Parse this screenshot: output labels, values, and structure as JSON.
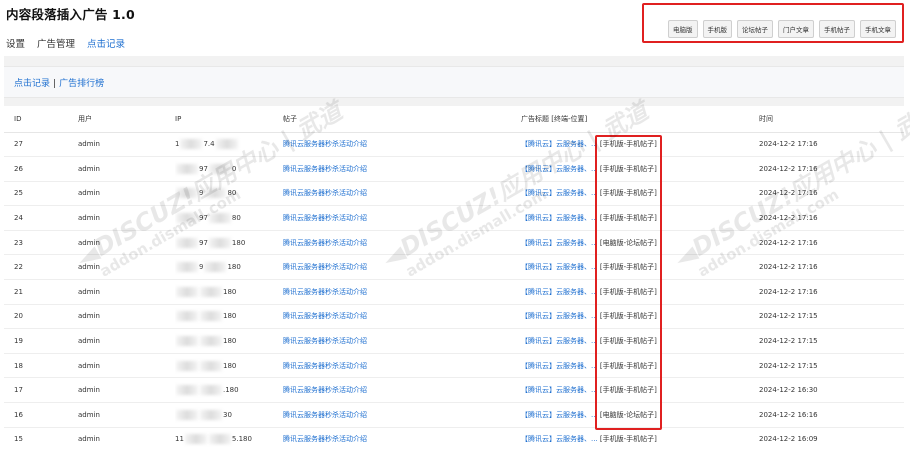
{
  "app": {
    "title": "内容段落插入广告 1.0"
  },
  "tabs": [
    {
      "label": "设置",
      "active": false
    },
    {
      "label": "广告管理",
      "active": false
    },
    {
      "label": "点击记录",
      "active": true
    }
  ],
  "breadcrumb": {
    "current": "点击记录",
    "separator": "|",
    "link": "广告排行榜"
  },
  "filters": [
    "电脑版",
    "手机版",
    "论坛帖子",
    "门户文章",
    "手机帖子",
    "手机文章"
  ],
  "table": {
    "headers": {
      "id": "ID",
      "user": "用户",
      "ip": "IP",
      "post": "帖子",
      "ad": "广告标题 [终端-位置]",
      "time": "时间"
    },
    "rows": [
      {
        "id": "27",
        "user": "admin",
        "ip_a": "1",
        "ip_b": "7.4",
        "ip_c": "",
        "post": "腾讯云服务器秒杀活动介绍",
        "ad_title": "【腾讯云】云服务器、...",
        "ad_pos": "[手机版-手机帖子]",
        "time": "2024-12-2 17:16"
      },
      {
        "id": "26",
        "user": "admin",
        "ip_a": "",
        "ip_b": "97",
        "ip_c": "0",
        "post": "腾讯云服务器秒杀活动介绍",
        "ad_title": "【腾讯云】云服务器、...",
        "ad_pos": "[手机版-手机帖子]",
        "time": "2024-12-2 17:16"
      },
      {
        "id": "25",
        "user": "admin",
        "ip_a": "",
        "ip_b": "9",
        "ip_c": "80",
        "post": "腾讯云服务器秒杀活动介绍",
        "ad_title": "【腾讯云】云服务器、...",
        "ad_pos": "[手机版-手机帖子]",
        "time": "2024-12-2 17:16"
      },
      {
        "id": "24",
        "user": "admin",
        "ip_a": "",
        "ip_b": "97",
        "ip_c": "80",
        "post": "腾讯云服务器秒杀活动介绍",
        "ad_title": "【腾讯云】云服务器、...",
        "ad_pos": "[手机版-手机帖子]",
        "time": "2024-12-2 17:16"
      },
      {
        "id": "23",
        "user": "admin",
        "ip_a": "",
        "ip_b": "97",
        "ip_c": "180",
        "post": "腾讯云服务器秒杀活动介绍",
        "ad_title": "【腾讯云】云服务器、...",
        "ad_pos": "[电脑版-论坛帖子]",
        "time": "2024-12-2 17:16"
      },
      {
        "id": "22",
        "user": "admin",
        "ip_a": "",
        "ip_b": "9",
        "ip_c": "180",
        "post": "腾讯云服务器秒杀活动介绍",
        "ad_title": "【腾讯云】云服务器、...",
        "ad_pos": "[手机版-手机帖子]",
        "time": "2024-12-2 17:16"
      },
      {
        "id": "21",
        "user": "admin",
        "ip_a": "",
        "ip_b": "",
        "ip_c": "180",
        "post": "腾讯云服务器秒杀活动介绍",
        "ad_title": "【腾讯云】云服务器、...",
        "ad_pos": "[手机版-手机帖子]",
        "time": "2024-12-2 17:16"
      },
      {
        "id": "20",
        "user": "admin",
        "ip_a": "",
        "ip_b": "",
        "ip_c": "180",
        "post": "腾讯云服务器秒杀活动介绍",
        "ad_title": "【腾讯云】云服务器、...",
        "ad_pos": "[手机版-手机帖子]",
        "time": "2024-12-2 17:15"
      },
      {
        "id": "19",
        "user": "admin",
        "ip_a": "",
        "ip_b": "",
        "ip_c": "180",
        "post": "腾讯云服务器秒杀活动介绍",
        "ad_title": "【腾讯云】云服务器、...",
        "ad_pos": "[手机版-手机帖子]",
        "time": "2024-12-2 17:15"
      },
      {
        "id": "18",
        "user": "admin",
        "ip_a": "",
        "ip_b": "",
        "ip_c": "180",
        "post": "腾讯云服务器秒杀活动介绍",
        "ad_title": "【腾讯云】云服务器、...",
        "ad_pos": "[手机版-手机帖子]",
        "time": "2024-12-2 17:15"
      },
      {
        "id": "17",
        "user": "admin",
        "ip_a": "",
        "ip_b": "",
        "ip_c": ".180",
        "post": "腾讯云服务器秒杀活动介绍",
        "ad_title": "【腾讯云】云服务器、...",
        "ad_pos": "[手机版-手机帖子]",
        "time": "2024-12-2 16:30"
      },
      {
        "id": "16",
        "user": "admin",
        "ip_a": "",
        "ip_b": "",
        "ip_c": "30",
        "post": "腾讯云服务器秒杀活动介绍",
        "ad_title": "【腾讯云】云服务器、...",
        "ad_pos": "[电脑版-论坛帖子]",
        "time": "2024-12-2 16:16"
      },
      {
        "id": "15",
        "user": "admin",
        "ip_a": "11",
        "ip_b": "",
        "ip_c": "5.180",
        "post": "腾讯云服务器秒杀活动介绍",
        "ad_title": "【腾讯云】云服务器、...",
        "ad_pos": "[手机版-手机帖子]",
        "time": "2024-12-2 16:09"
      }
    ]
  },
  "watermark": {
    "brand": "DISCUZ!应用中心 | 武道",
    "site": "addon.dismall.com",
    "icon": "arrow-icon"
  },
  "colors": {
    "accent": "#1e6fd0",
    "highlight": "#e02020"
  }
}
